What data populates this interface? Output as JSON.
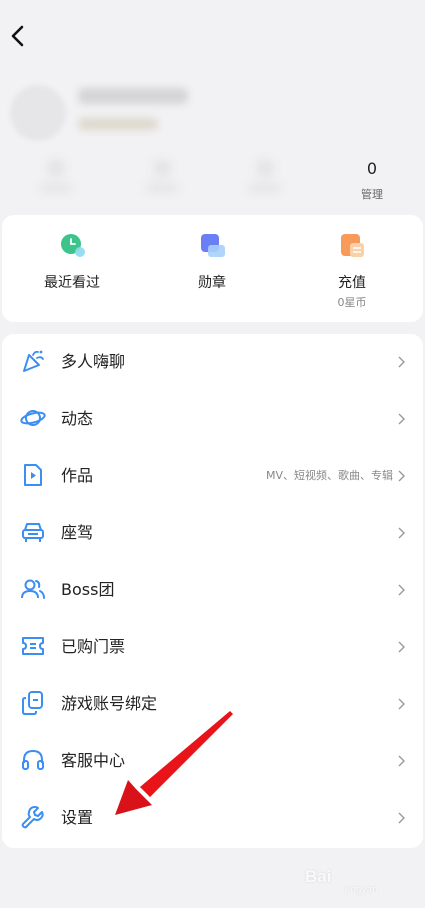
{
  "nav": {
    "back_icon": "chevron-left-icon"
  },
  "stats": {
    "manage_count": "0",
    "manage_label": "管理"
  },
  "quick": [
    {
      "label": "最近看过",
      "sub": "",
      "icon": "clock-icon",
      "color": "#3dc48a"
    },
    {
      "label": "勋章",
      "sub": "",
      "icon": "medal-icon",
      "color": "#6a7ff5"
    },
    {
      "label": "充值",
      "sub": "0星币",
      "icon": "wallet-icon",
      "color": "#f79a5a"
    }
  ],
  "menu": [
    {
      "label": "多人嗨聊",
      "hint": "",
      "icon": "party-popper-icon"
    },
    {
      "label": "动态",
      "hint": "",
      "icon": "planet-icon"
    },
    {
      "label": "作品",
      "hint": "MV、短视频、歌曲、专辑",
      "icon": "video-file-icon"
    },
    {
      "label": "座驾",
      "hint": "",
      "icon": "car-icon"
    },
    {
      "label": "Boss团",
      "hint": "",
      "icon": "group-icon"
    },
    {
      "label": "已购门票",
      "hint": "",
      "icon": "ticket-icon"
    },
    {
      "label": "游戏账号绑定",
      "hint": "",
      "icon": "link-copy-icon"
    },
    {
      "label": "客服中心",
      "hint": "",
      "icon": "headset-icon"
    },
    {
      "label": "设置",
      "hint": "",
      "icon": "wrench-icon"
    }
  ],
  "colors": {
    "icon_blue": "#3b8ff2",
    "annotation_red": "#e8141a"
  },
  "watermark": {
    "text": "Bai",
    "sub": "jingyan"
  }
}
